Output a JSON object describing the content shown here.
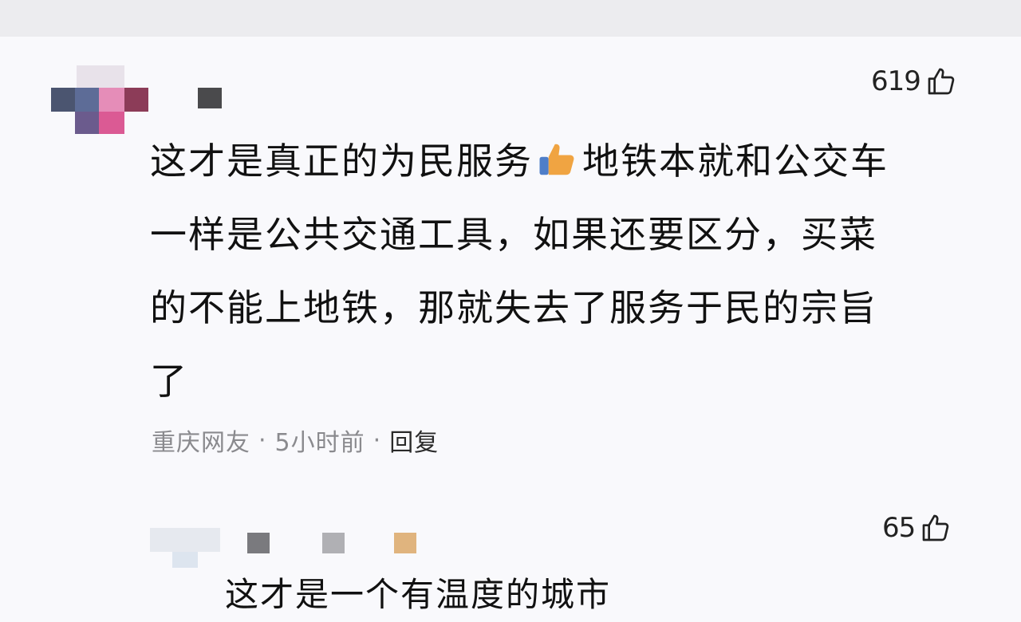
{
  "comments": [
    {
      "likes": "619",
      "text_lines": [
        "这才是真正的为民服务",
        "地铁本就和公交车",
        "一样是公共交通工具，如果还要区分，买菜",
        "的不能上地铁，那就失去了服务于民的宗旨",
        "了"
      ],
      "emoji": "thumbs-up-icon",
      "meta": {
        "location": "重庆网友",
        "time": "5小时前",
        "separator": "·",
        "reply": "回复"
      }
    },
    {
      "likes": "65",
      "text": "这才是一个有温度的城市"
    }
  ],
  "colors": {
    "background": "#f9f9fc",
    "text": "#111111",
    "meta_text": "#8a8a8e",
    "emoji": "#f0a442"
  }
}
